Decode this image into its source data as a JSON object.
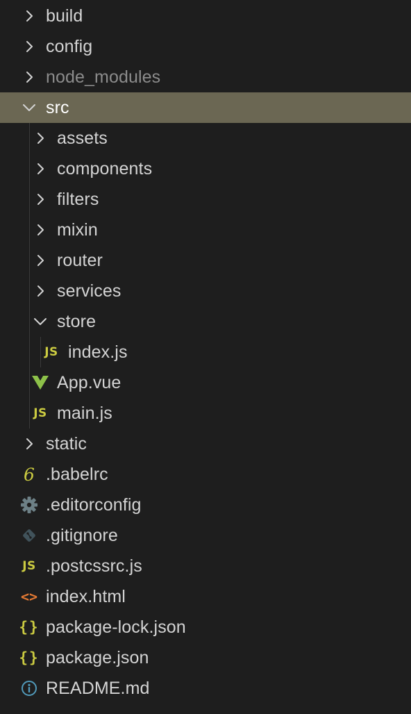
{
  "explorer": {
    "items": [
      {
        "label": "build",
        "kind": "folder",
        "expanded": false,
        "depth": 0,
        "icon": "chevron-right-icon"
      },
      {
        "label": "config",
        "kind": "folder",
        "expanded": false,
        "depth": 0,
        "icon": "chevron-right-icon"
      },
      {
        "label": "node_modules",
        "kind": "folder",
        "expanded": false,
        "depth": 0,
        "icon": "chevron-right-icon",
        "dimmed": true
      },
      {
        "label": "src",
        "kind": "folder",
        "expanded": true,
        "depth": 0,
        "icon": "chevron-down-icon",
        "selected": true
      },
      {
        "label": "assets",
        "kind": "folder",
        "expanded": false,
        "depth": 1,
        "icon": "chevron-right-icon"
      },
      {
        "label": "components",
        "kind": "folder",
        "expanded": false,
        "depth": 1,
        "icon": "chevron-right-icon"
      },
      {
        "label": "filters",
        "kind": "folder",
        "expanded": false,
        "depth": 1,
        "icon": "chevron-right-icon"
      },
      {
        "label": "mixin",
        "kind": "folder",
        "expanded": false,
        "depth": 1,
        "icon": "chevron-right-icon"
      },
      {
        "label": "router",
        "kind": "folder",
        "expanded": false,
        "depth": 1,
        "icon": "chevron-right-icon"
      },
      {
        "label": "services",
        "kind": "folder",
        "expanded": false,
        "depth": 1,
        "icon": "chevron-right-icon"
      },
      {
        "label": "store",
        "kind": "folder",
        "expanded": true,
        "depth": 1,
        "icon": "chevron-down-icon"
      },
      {
        "label": "index.js",
        "kind": "file",
        "depth": 2,
        "icon": "javascript-icon",
        "icon_text": "JS"
      },
      {
        "label": "App.vue",
        "kind": "file",
        "depth": 1,
        "icon": "vue-icon"
      },
      {
        "label": "main.js",
        "kind": "file",
        "depth": 1,
        "icon": "javascript-icon",
        "icon_text": "JS"
      },
      {
        "label": "static",
        "kind": "folder",
        "expanded": false,
        "depth": 0,
        "icon": "chevron-right-icon"
      },
      {
        "label": ".babelrc",
        "kind": "file",
        "depth": 0,
        "icon": "babel-icon",
        "icon_text": "6"
      },
      {
        "label": ".editorconfig",
        "kind": "file",
        "depth": 0,
        "icon": "gear-icon"
      },
      {
        "label": ".gitignore",
        "kind": "file",
        "depth": 0,
        "icon": "git-icon"
      },
      {
        "label": ".postcssrc.js",
        "kind": "file",
        "depth": 0,
        "icon": "javascript-icon",
        "icon_text": "JS"
      },
      {
        "label": "index.html",
        "kind": "file",
        "depth": 0,
        "icon": "html-icon",
        "icon_text": "<>"
      },
      {
        "label": "package-lock.json",
        "kind": "file",
        "depth": 0,
        "icon": "json-icon",
        "icon_text": "{}"
      },
      {
        "label": "package.json",
        "kind": "file",
        "depth": 0,
        "icon": "json-icon",
        "icon_text": "{}"
      },
      {
        "label": "README.md",
        "kind": "file",
        "depth": 0,
        "icon": "info-icon"
      }
    ]
  },
  "colors": {
    "background": "#1e1e1e",
    "selected_row": "#6b6753",
    "text": "#d4d4d4",
    "dimmed_text": "#8c8c8c",
    "js_yellow": "#cbcb41",
    "vue_green": "#8dc149",
    "html_orange": "#e37933",
    "info_blue": "#519aba",
    "gear_grey": "#6d8086",
    "git_grey": "#41535b"
  }
}
